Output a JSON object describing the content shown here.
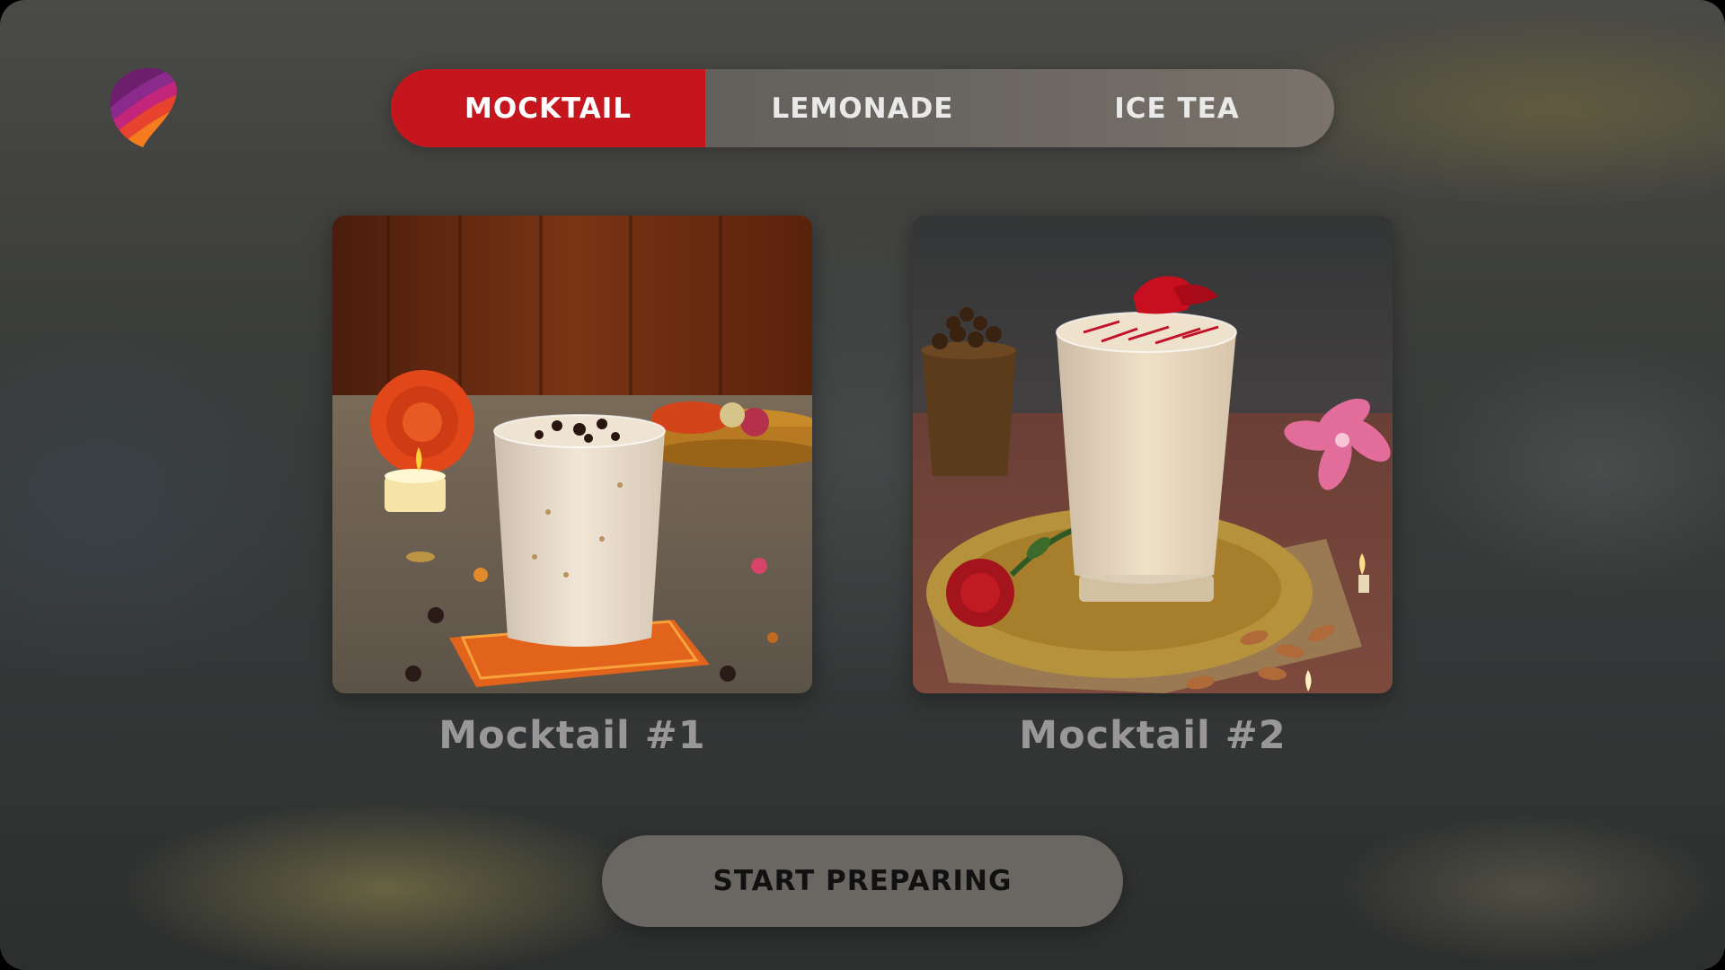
{
  "tabs": [
    {
      "label": "MOCKTAIL",
      "active": true
    },
    {
      "label": "LEMONADE",
      "active": false
    },
    {
      "label": "ICE TEA",
      "active": false
    }
  ],
  "drinks": [
    {
      "name": "Mocktail #1",
      "image": "mocktail-1-photo"
    },
    {
      "name": "Mocktail #2",
      "image": "mocktail-2-photo"
    }
  ],
  "action": {
    "start_label": "START PREPARING"
  },
  "colors": {
    "accent": "#c4161c",
    "tab_bar": "#6a6661",
    "button": "#6a6763"
  }
}
